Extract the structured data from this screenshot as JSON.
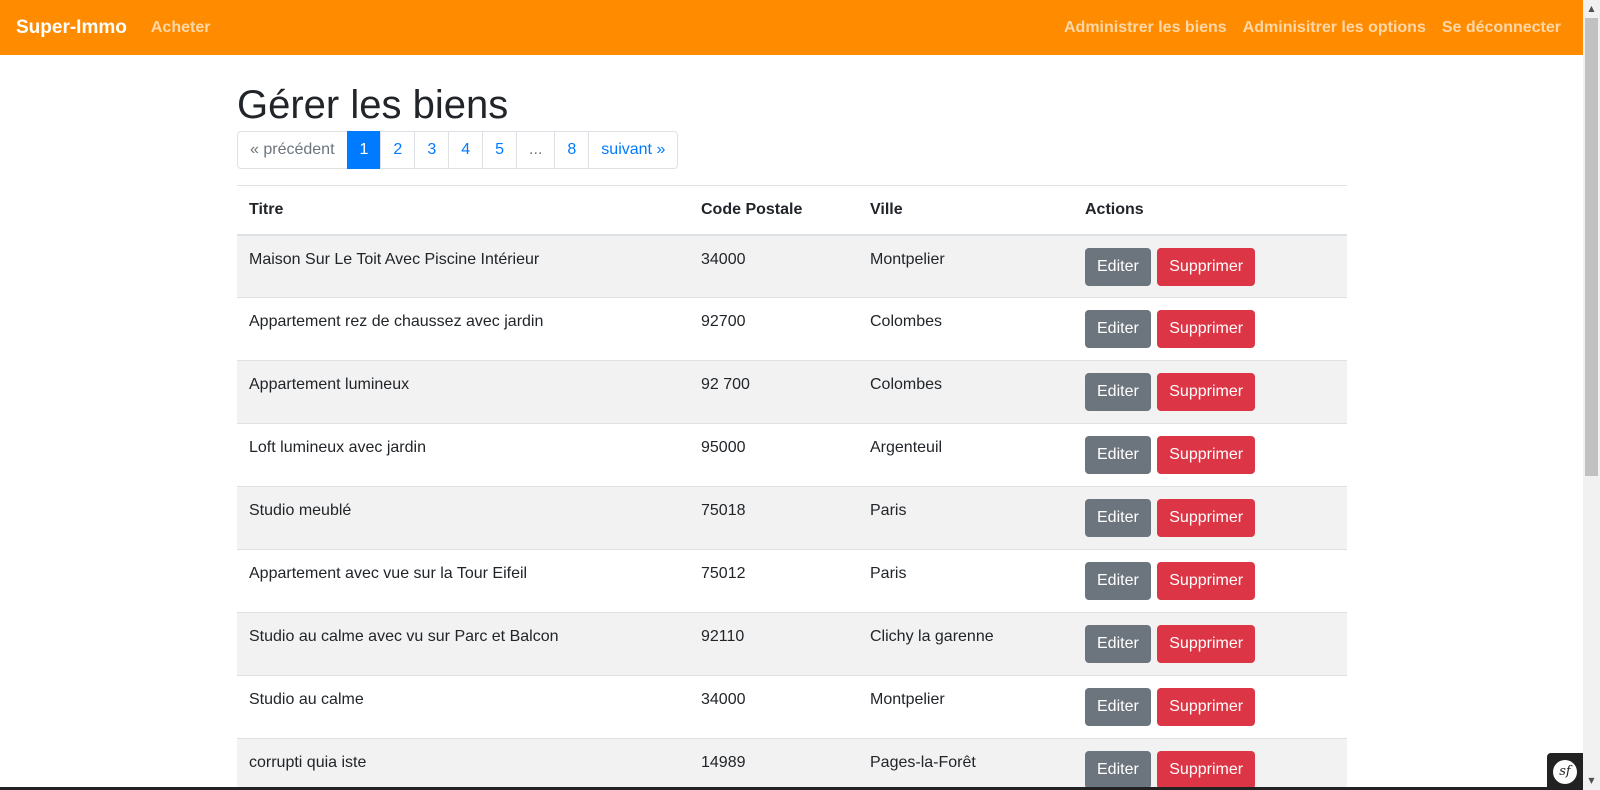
{
  "navbar": {
    "brand": "Super-Immo",
    "left_links": [
      "Acheter"
    ],
    "right_links": [
      "Administrer les biens",
      "Adminisitrer les options",
      "Se déconnecter"
    ],
    "bg_color": "#ff8c00"
  },
  "page": {
    "title": "Gérer les biens"
  },
  "pagination": {
    "prev": "« précédent",
    "pages": [
      "1",
      "2",
      "3",
      "4",
      "5",
      "...",
      "8"
    ],
    "active": "1",
    "next": "suivant »"
  },
  "table": {
    "headers": [
      "Titre",
      "Code Postale",
      "Ville",
      "Actions"
    ],
    "edit_label": "Editer",
    "delete_label": "Supprimer",
    "rows": [
      {
        "titre": "Maison Sur Le Toit Avec Piscine Intérieur",
        "code": "34000",
        "ville": "Montpelier"
      },
      {
        "titre": "Appartement rez de chaussez avec jardin",
        "code": "92700",
        "ville": "Colombes"
      },
      {
        "titre": "Appartement lumineux",
        "code": "92 700",
        "ville": "Colombes"
      },
      {
        "titre": "Loft lumineux avec jardin",
        "code": "95000",
        "ville": "Argenteuil"
      },
      {
        "titre": "Studio meublé",
        "code": "75018",
        "ville": "Paris"
      },
      {
        "titre": "Appartement avec vue sur la Tour Eifeil",
        "code": "75012",
        "ville": "Paris"
      },
      {
        "titre": "Studio au calme avec vu sur Parc et Balcon",
        "code": "92110",
        "ville": "Clichy la garenne"
      },
      {
        "titre": "Studio au calme",
        "code": "34000",
        "ville": "Montpelier"
      },
      {
        "titre": "corrupti quia iste",
        "code": "14989",
        "ville": "Pages-la-Forêt"
      }
    ]
  },
  "colors": {
    "edit_button": "#6c757d",
    "delete_button": "#dc3545",
    "link": "#007bff"
  },
  "icons": {
    "toolbar": "symfony-icon",
    "toolbar_glyph": "sf"
  }
}
